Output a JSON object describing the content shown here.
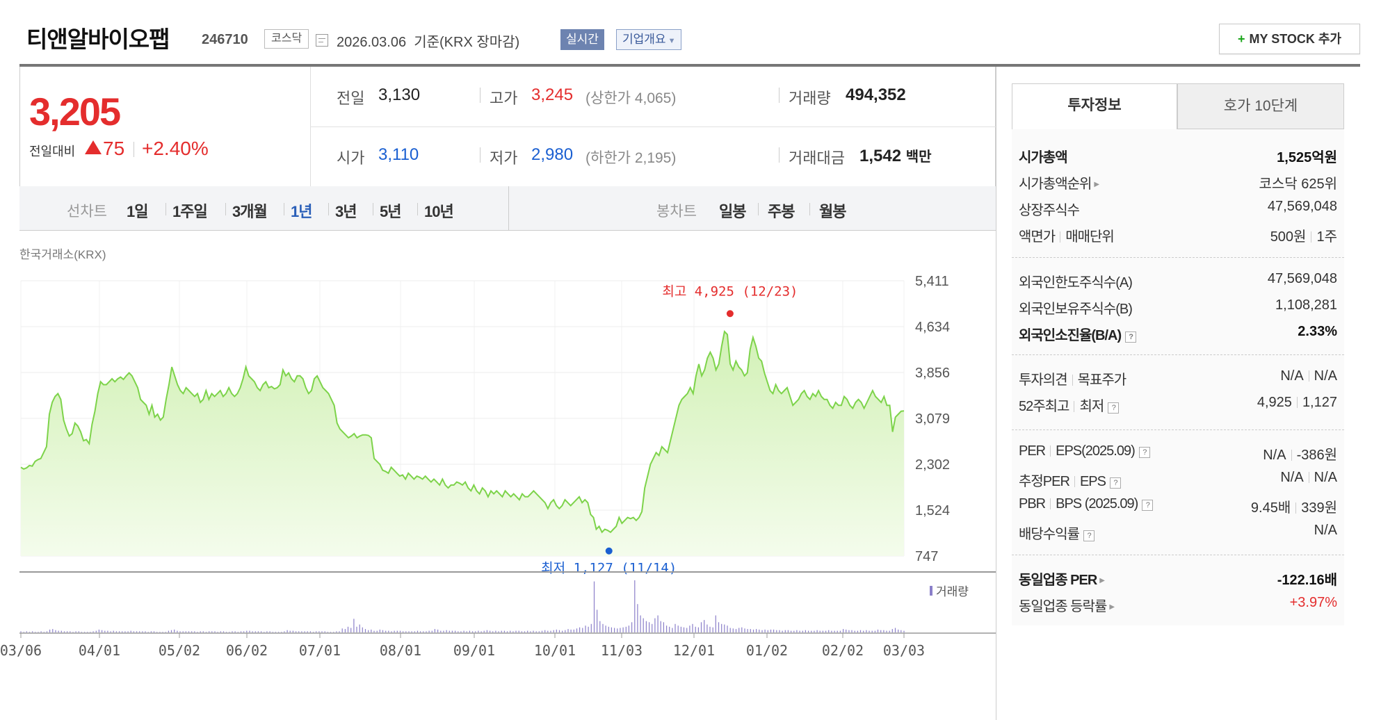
{
  "header": {
    "title": "티앤알바이오팹",
    "code": "246710",
    "market": "코스닥",
    "date_text": "2026.03.06  기준(KRX 장마감)",
    "realtime": "실시간",
    "company_info": "기업개요",
    "mystock": "MY STOCK 추가"
  },
  "quote": {
    "price": "3,205",
    "change_label": "전일대비",
    "change_amount": "75",
    "change_percent": "+2.40%",
    "prev_close_label": "전일",
    "prev_close": "3,130",
    "high_label": "고가",
    "high": "3,245",
    "upper_limit_label": "상한가",
    "upper_limit": "4,065",
    "volume_label": "거래량",
    "volume": "494,352",
    "open_label": "시가",
    "open": "3,110",
    "low_label": "저가",
    "low": "2,980",
    "lower_limit_label": "하한가",
    "lower_limit": "2,195",
    "amount_label": "거래대금",
    "amount": "1,542",
    "amount_unit": "백만",
    "colors": {
      "up": "#e42d2d",
      "down": "#1a5fd1"
    }
  },
  "period_bar": {
    "line_chart_label": "선차트",
    "line_periods": [
      "1일",
      "1주일",
      "3개월",
      "1년",
      "3년",
      "5년",
      "10년"
    ],
    "active_period": "1년",
    "candle_chart_label": "봉차트",
    "candle_periods": [
      "일봉",
      "주봉",
      "월봉"
    ]
  },
  "exchange_label": "한국거래소(KRX)",
  "chart_data": {
    "type": "area",
    "ylim": [
      747,
      5411
    ],
    "y_ticks": [
      "5,411",
      "4,634",
      "3,856",
      "3,079",
      "2,302",
      "1,524",
      "747"
    ],
    "x_ticks": [
      "03/06",
      "04/01",
      "05/02",
      "06/02",
      "07/01",
      "08/01",
      "09/01",
      "10/01",
      "11/03",
      "12/01",
      "01/02",
      "02/02",
      "03/03"
    ],
    "high_annotation": {
      "label": "최고 4,925 (12/23)",
      "value": 4925
    },
    "low_annotation": {
      "label": "최저 1,127 (11/14)",
      "value": 1127
    },
    "volume_legend": "거래량",
    "series": [
      {
        "values": [
          2250,
          2220,
          2240,
          2280,
          2270,
          2350,
          2380,
          2400,
          2500,
          2600,
          3150,
          3350,
          3450,
          3500,
          3400,
          3050,
          2900,
          2780,
          2820,
          3000,
          2950,
          2850,
          2700,
          2720,
          2650,
          2980,
          3200,
          3500,
          3700,
          3650,
          3650,
          3700,
          3750,
          3700,
          3750,
          3780,
          3740,
          3800,
          3850,
          3800,
          3700,
          3600,
          3400,
          3350,
          3300,
          3150,
          3300,
          3100,
          3150,
          3050,
          3100,
          3400,
          3650,
          3950,
          3800,
          3650,
          3550,
          3500,
          3600,
          3550,
          3500,
          3450,
          3500,
          3350,
          3400,
          3550,
          3400,
          3500,
          3450,
          3500,
          3550,
          3450,
          3500,
          3600,
          3500,
          3450,
          3500,
          3600,
          3750,
          3950,
          3800,
          3750,
          3700,
          3600,
          3550,
          3650,
          3700,
          3600,
          3620,
          3580,
          3600,
          3650,
          3900,
          3800,
          3850,
          3750,
          3700,
          3800,
          3800,
          3750,
          3600,
          3500,
          3550,
          3750,
          3800,
          3700,
          3600,
          3550,
          3500,
          3400,
          3300,
          3000,
          2900,
          2850,
          2800,
          2750,
          2780,
          2820,
          2750,
          2780,
          2800,
          2800,
          2790,
          2750,
          2400,
          2350,
          2300,
          2200,
          2180,
          2150,
          2250,
          2200,
          2150,
          2100,
          2120,
          2050,
          2150,
          2100,
          2050,
          2100,
          2080,
          2050,
          2100,
          2050,
          2000,
          2050,
          2000,
          1950,
          2050,
          1950,
          1900,
          1950,
          1950,
          2000,
          1980,
          1950,
          2000,
          1900,
          1850,
          1950,
          1850,
          1800,
          1900,
          1850,
          1750,
          1850,
          1800,
          1850,
          1800,
          1750,
          1850,
          1800,
          1750,
          1800,
          1750,
          1700,
          1800,
          1750,
          1750,
          1800,
          1850,
          1800,
          1750,
          1700,
          1650,
          1550,
          1650,
          1700,
          1600,
          1550,
          1600,
          1700,
          1650,
          1600,
          1650,
          1700,
          1750,
          1650,
          1700,
          1650,
          1450,
          1400,
          1200,
          1250,
          1150,
          1200,
          1180,
          1150,
          1200,
          1250,
          1400,
          1300,
          1350,
          1400,
          1380,
          1400,
          1350,
          1400,
          1500,
          1900,
          2100,
          2300,
          2400,
          2500,
          2450,
          2600,
          2550,
          2500,
          2700,
          2900,
          3100,
          3300,
          3400,
          3450,
          3500,
          3600,
          3500,
          3800,
          4000,
          3800,
          3900,
          4100,
          4200,
          4100,
          3900,
          4000,
          4300,
          4550,
          4500,
          4000,
          3900,
          4050,
          3950,
          3900,
          3800,
          3850,
          4250,
          4450,
          4300,
          4100,
          4050,
          3850,
          3700,
          3550,
          3500,
          3650,
          3550,
          3500,
          3550,
          3600,
          3450,
          3300,
          3350,
          3400,
          3500,
          3550,
          3450,
          3400,
          3500,
          3450,
          3550,
          3450,
          3400,
          3400,
          3300,
          3250,
          3350,
          3300,
          3300,
          3450,
          3400,
          3300,
          3250,
          3350,
          3400,
          3350,
          3250,
          3350,
          3450,
          3550,
          3450,
          3400,
          3350,
          3450,
          3300,
          3300,
          2850,
          3100,
          3150,
          3200,
          3205
        ]
      }
    ],
    "volume_values": [
      2,
      1,
      2,
      1,
      2,
      1,
      1,
      2,
      1,
      2,
      5,
      6,
      4,
      3,
      3,
      2,
      2,
      2,
      1,
      2,
      2,
      1,
      1,
      1,
      1,
      2,
      3,
      5,
      4,
      3,
      3,
      2,
      3,
      2,
      2,
      2,
      2,
      2,
      3,
      2,
      2,
      2,
      2,
      2,
      1,
      2,
      2,
      1,
      1,
      1,
      1,
      3,
      4,
      5,
      3,
      2,
      2,
      2,
      2,
      2,
      2,
      1,
      2,
      2,
      1,
      2,
      2,
      2,
      1,
      2,
      2,
      1,
      1,
      2,
      2,
      1,
      2,
      2,
      3,
      3,
      2,
      2,
      2,
      2,
      1,
      2,
      2,
      1,
      1,
      1,
      1,
      2,
      4,
      3,
      3,
      2,
      2,
      2,
      2,
      2,
      2,
      1,
      2,
      2,
      2,
      2,
      1,
      1,
      1,
      2,
      2,
      7,
      6,
      10,
      8,
      24,
      10,
      14,
      9,
      6,
      4,
      5,
      3,
      3,
      5,
      4,
      3,
      3,
      2,
      3,
      3,
      3,
      2,
      2,
      2,
      2,
      2,
      3,
      2,
      2,
      2,
      3,
      3,
      6,
      5,
      3,
      3,
      4,
      3,
      3,
      3,
      2,
      2,
      3,
      2,
      3,
      2,
      2,
      3,
      2,
      3,
      4,
      3,
      2,
      3,
      2,
      3,
      3,
      2,
      3,
      2,
      3,
      3,
      2,
      2,
      3,
      2,
      3,
      2,
      2,
      3,
      4,
      3,
      3,
      4,
      5,
      4,
      3,
      4,
      6,
      5,
      5,
      7,
      9,
      8,
      12,
      10,
      15,
      90,
      40,
      20,
      15,
      12,
      10,
      9,
      8,
      7,
      8,
      9,
      10,
      12,
      18,
      92,
      50,
      30,
      25,
      20,
      18,
      15,
      25,
      30,
      20,
      18,
      12,
      10,
      8,
      15,
      12,
      10,
      9,
      8,
      12,
      15,
      10,
      9,
      18,
      22,
      14,
      10,
      9,
      30,
      18,
      15,
      14,
      12,
      8,
      7,
      6,
      8,
      9,
      7,
      6,
      6,
      5,
      6,
      5,
      4,
      5,
      4,
      5,
      5,
      4,
      4,
      3,
      4,
      4,
      3,
      3,
      4,
      3,
      3,
      4,
      3,
      3,
      3,
      4,
      3,
      3,
      3,
      4,
      3,
      3,
      3,
      3,
      6,
      5,
      4,
      4,
      3,
      3,
      4,
      3,
      4,
      3,
      3,
      3,
      5,
      4,
      4,
      3,
      3,
      6,
      8,
      5,
      4,
      3
    ]
  },
  "right_panel": {
    "tabs": [
      "투자정보",
      "호가 10단계"
    ],
    "section1": [
      {
        "label": "시가총액",
        "value": "1,525억원",
        "bold": true
      },
      {
        "label": "시가총액순위",
        "value": "코스닥 625위",
        "arrow": true
      },
      {
        "label": "상장주식수",
        "value": "47,569,048"
      },
      {
        "label": "액면가",
        "label2": "매매단위",
        "value": "500원",
        "value2": "1주"
      }
    ],
    "section2": [
      {
        "label": "외국인한도주식수(A)",
        "value": "47,569,048"
      },
      {
        "label": "외국인보유주식수(B)",
        "value": "1,108,281"
      },
      {
        "label": "외국인소진율(B/A)",
        "value": "2.33%",
        "bold": true,
        "tip": true
      }
    ],
    "section3": [
      {
        "label": "투자의견",
        "label2": "목표주가",
        "value": "N/A",
        "value2": "N/A"
      },
      {
        "label": "52주최고",
        "label2": "최저",
        "value": "4,925",
        "value2": "1,127",
        "tip": true
      }
    ],
    "section4": [
      {
        "label": "PER",
        "label2": "EPS(2025.09)",
        "value": "N/A",
        "value2": "-386원",
        "tip": true
      },
      {
        "label": "추정PER",
        "label2": "EPS",
        "value": "N/A",
        "value2": "N/A",
        "tip": true
      },
      {
        "label": "PBR",
        "label2": "BPS (2025.09)",
        "value": "9.45배",
        "value2": "339원",
        "tip": true
      },
      {
        "label": "배당수익률",
        "value": "N/A",
        "tip": true
      }
    ],
    "section5": [
      {
        "label": "동일업종 PER",
        "value": "-122.16배",
        "bold": true,
        "arrow": true
      },
      {
        "label": "동일업종 등락률",
        "value": "+3.97%",
        "arrow": true,
        "red": true
      }
    ]
  }
}
